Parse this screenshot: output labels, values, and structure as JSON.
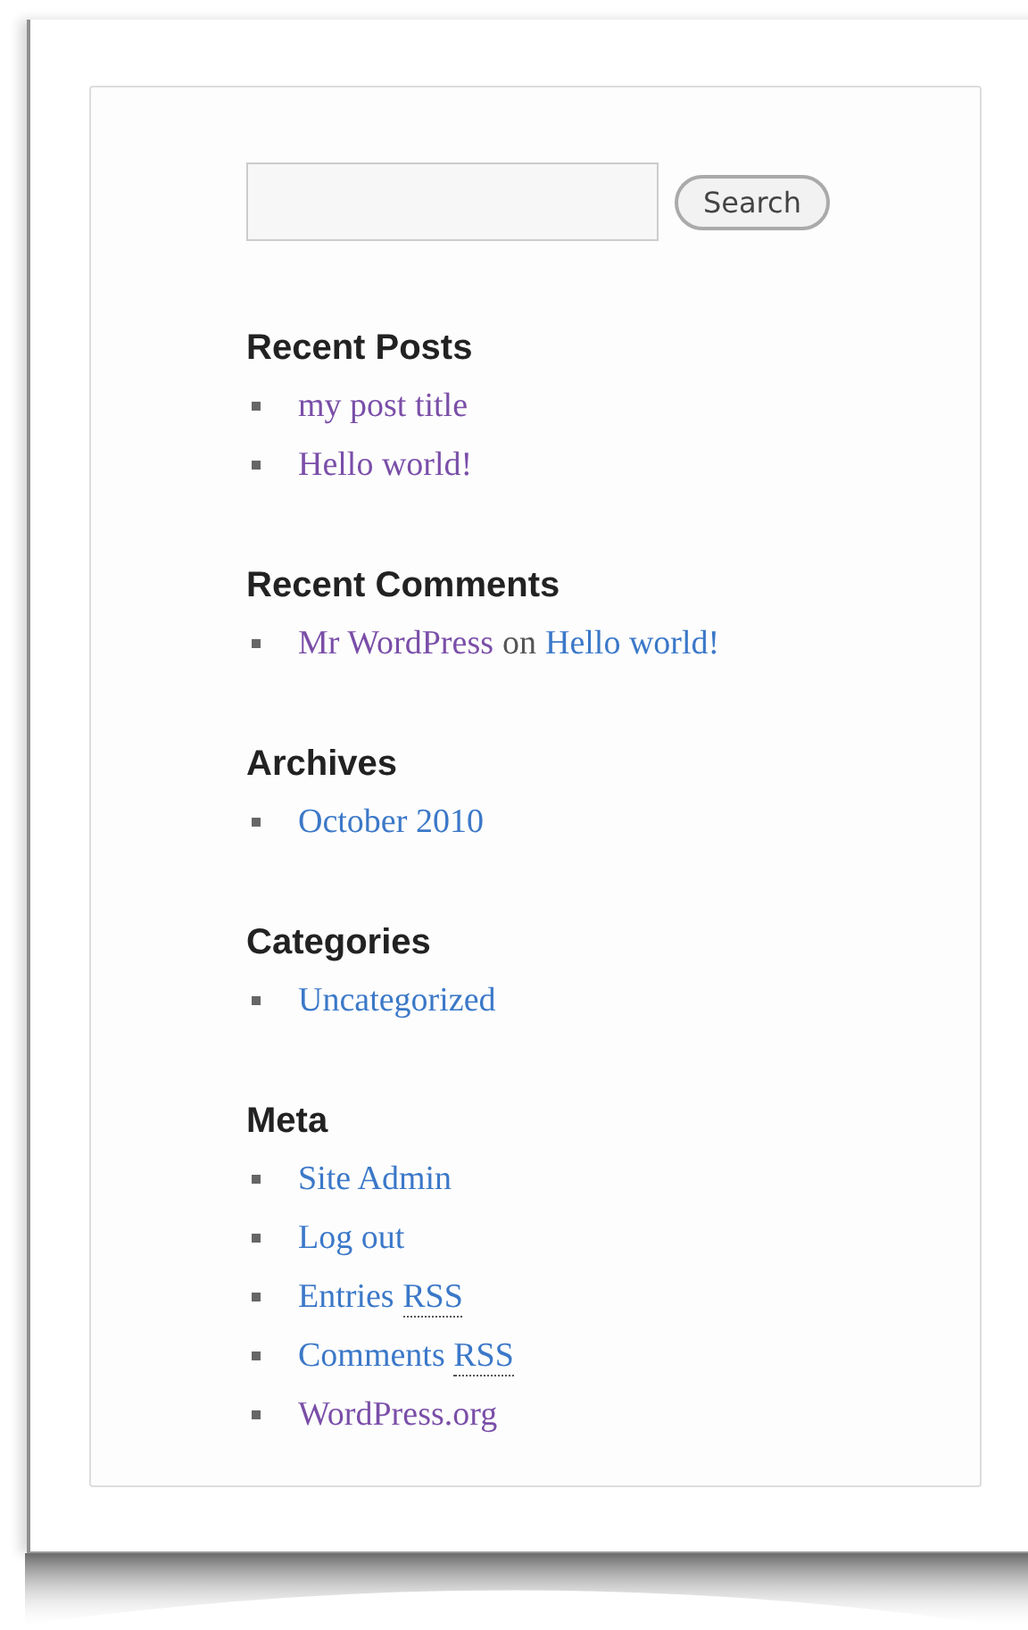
{
  "search": {
    "button": "Search"
  },
  "widgets": [
    {
      "kind": "list",
      "title": "Recent Posts",
      "items": [
        {
          "label": "my post title",
          "visited": true
        },
        {
          "label": "Hello world!",
          "visited": true
        }
      ]
    },
    {
      "kind": "comments",
      "title": "Recent Comments",
      "items": [
        {
          "author": "Mr WordPress",
          "author_visited": true,
          "joiner": "on",
          "post": "Hello world!",
          "post_visited": false
        }
      ]
    },
    {
      "kind": "list",
      "title": "Archives",
      "items": [
        {
          "label": "October 2010",
          "visited": false
        }
      ]
    },
    {
      "kind": "list",
      "title": "Categories",
      "items": [
        {
          "label": "Uncategorized",
          "visited": false
        }
      ]
    },
    {
      "kind": "list",
      "title": "Meta",
      "items": [
        {
          "label": "Site Admin",
          "visited": false
        },
        {
          "label": "Log out",
          "visited": false
        },
        {
          "label": "Entries",
          "abbr": "RSS",
          "visited": false
        },
        {
          "label": "Comments",
          "abbr": "RSS",
          "visited": false
        },
        {
          "label": "WordPress.org",
          "visited": true
        }
      ]
    }
  ]
}
